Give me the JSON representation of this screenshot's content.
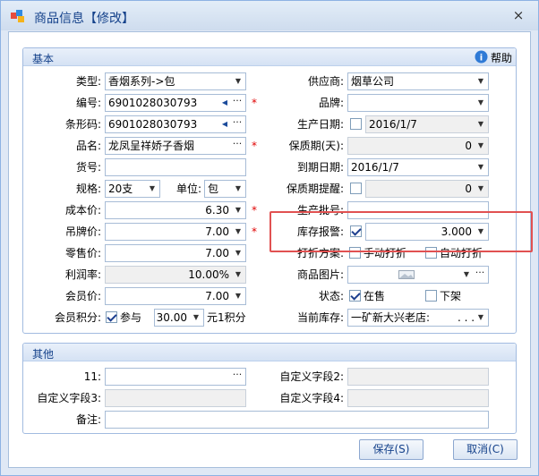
{
  "window": {
    "title": "商品信息【修改】",
    "close": "×"
  },
  "basic": {
    "title": "基本",
    "help": "帮助",
    "labels": {
      "category": "类型:",
      "code": "编号:",
      "barcode": "条形码:",
      "name": "品名:",
      "item_no": "货号:",
      "spec": "规格:",
      "unit": "单位:",
      "cost": "成本价:",
      "tag_price": "吊牌价:",
      "retail": "零售价:",
      "margin": "利润率:",
      "member_price": "会员价:",
      "member_points": "会员积分:",
      "supplier": "供应商:",
      "brand": "品牌:",
      "prod_date": "生产日期:",
      "shelf_life": "保质期(天):",
      "expiry": "到期日期:",
      "expiry_alert": "保质期提醒:",
      "batch": "生产批号:",
      "stock_alert": "库存报警:",
      "discount": "打折方案:",
      "image": "商品图片:",
      "status": "状态:",
      "current_stock": "当前库存:"
    },
    "values": {
      "category": "香烟系列->包",
      "code": "6901028030793",
      "barcode": "6901028030793",
      "name": "龙凤呈祥娇子香烟",
      "item_no": "",
      "spec": "20支",
      "unit": "包",
      "cost": "6.30",
      "tag_price": "7.00",
      "retail": "7.00",
      "margin": "10.00%",
      "member_price": "7.00",
      "points_join": "参与",
      "points_value": "30.00",
      "points_unit": "元1积分",
      "supplier": "烟草公司",
      "brand": "",
      "prod_date": "2016/1/7",
      "shelf_life": "0",
      "expiry": "2016/1/7",
      "expiry_alert": "0",
      "batch": "",
      "stock_alert": "3.000",
      "manual_discount": "手动打折",
      "auto_discount": "自动打折",
      "status_on": "在售",
      "status_off": "下架",
      "current_stock": "一矿新大兴老店:",
      "current_stock_dots": ". . ."
    },
    "required_mark": "*"
  },
  "other": {
    "title": "其他",
    "labels": {
      "f11": "11:",
      "custom2": "自定义字段2:",
      "custom3": "自定义字段3:",
      "custom4": "自定义字段4:",
      "note": "备注:"
    }
  },
  "buttons": {
    "save": "保存(S)",
    "cancel": "取消(C)"
  },
  "colors": {
    "title_text": "#15428b",
    "required": "#e00000",
    "highlight": "#e15151"
  }
}
